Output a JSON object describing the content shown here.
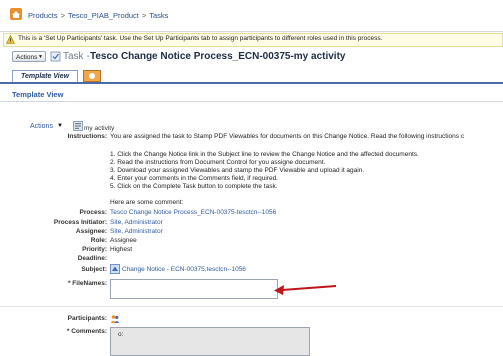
{
  "breadcrumb": {
    "items": [
      "Products",
      "Tesco_PIAB_Product",
      "Tasks"
    ],
    "sep": ">"
  },
  "info": {
    "text": "This is a 'Set Up Participants' task. Use the Set Up Participants tab to assign participants to different roles used in this process."
  },
  "header": {
    "actions_label": "Actions",
    "task_label": "Task -",
    "title": "Tesco Change Notice Process_ECN-00375-my activity"
  },
  "tabs": [
    {
      "label": "Template View"
    }
  ],
  "template_header": "Template View",
  "body": {
    "actions_link": "Actions",
    "activity_label": "my activity",
    "instructions_label": "Instructions:",
    "instructions_intro": "You are assigned the task to Stamp PDF Viewables for documents on this Change Notice. Read the following instructions c",
    "steps": [
      "1. Click the Change Notice link in the Subject line to review the Change Notice and the affected documents.",
      "2. Read the instructions from Document Control for you assigne document.",
      "3. Download your assigned Viewables and stamp the PDF Viewable and upload it again.",
      "4. Enter your comments in the Comments field, if required.",
      "5. Click on the Complete Task button to complete the task."
    ],
    "comment_intro": "Here are some comment:",
    "fields": {
      "process_label": "Process:",
      "process_value": "Tesco Change Notice Process_ECN-00375-tesctcn--1056",
      "initiator_label": "Process Initiator:",
      "initiator_value": "Site, Administrator",
      "assignee_label": "Assignee:",
      "assignee_value": "Site, Administrator",
      "role_label": "Role:",
      "role_value": "Assignee",
      "priority_label": "Priority:",
      "priority_value": "Highest",
      "deadline_label": "Deadline:",
      "deadline_value": "",
      "subject_label": "Subject:",
      "subject_value": "Change Notice - ECN-00375,tesctcn--1056",
      "filenames_label": "* FileNames:",
      "filenames_value": "",
      "participants_label": "Participants:",
      "comments_label": "* Comments:",
      "comments_value": "ο:"
    }
  },
  "colors": {
    "link": "#2f5aa0",
    "tab_border": "#4a6aa8",
    "annotation_arrow": "#c0151b",
    "info_bg": "#fffde6"
  }
}
